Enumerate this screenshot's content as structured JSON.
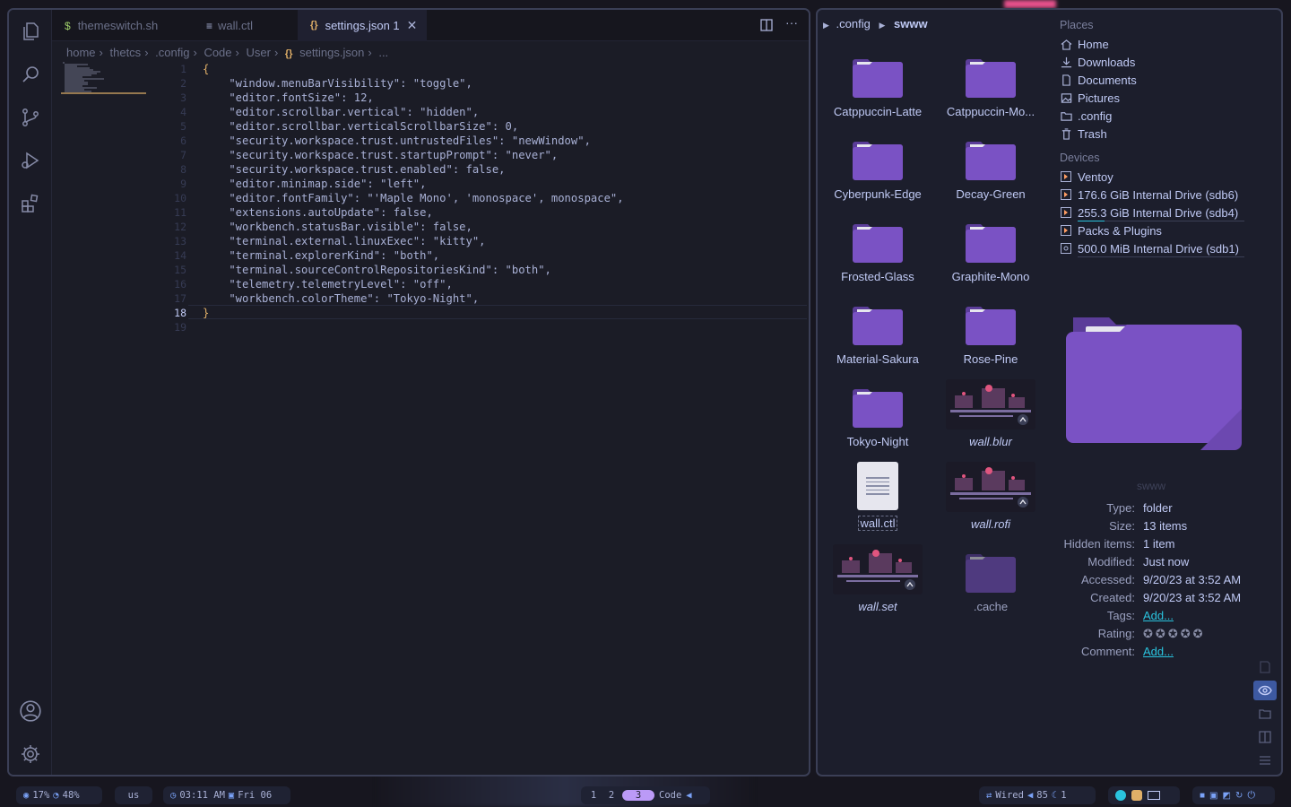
{
  "editor": {
    "tabs": [
      {
        "icon": "$",
        "label": "themeswitch.sh"
      },
      {
        "icon": "≡",
        "label": "wall.ctl"
      },
      {
        "icon": "{}",
        "label": "settings.json 1"
      }
    ],
    "breadcrumb": [
      "home",
      "thetcs",
      ".config",
      "Code",
      "User",
      "settings.json",
      "..."
    ],
    "line_numbers": [
      "1",
      "2",
      "3",
      "4",
      "5",
      "6",
      "7",
      "8",
      "9",
      "10",
      "11",
      "12",
      "13",
      "14",
      "15",
      "16",
      "17",
      "18",
      "19"
    ],
    "code_lines": [
      "{",
      "    \"window.menuBarVisibility\": \"toggle\",",
      "    \"editor.fontSize\": 12,",
      "    \"editor.scrollbar.vertical\": \"hidden\",",
      "    \"editor.scrollbar.verticalScrollbarSize\": 0,",
      "    \"security.workspace.trust.untrustedFiles\": \"newWindow\",",
      "    \"security.workspace.trust.startupPrompt\": \"never\",",
      "    \"security.workspace.trust.enabled\": false,",
      "    \"editor.minimap.side\": \"left\",",
      "    \"editor.fontFamily\": \"'Maple Mono', 'monospace', monospace\",",
      "    \"extensions.autoUpdate\": false,",
      "    \"workbench.statusBar.visible\": false,",
      "    \"terminal.external.linuxExec\": \"kitty\",",
      "    \"terminal.explorerKind\": \"both\",",
      "    \"terminal.sourceControlRepositoriesKind\": \"both\",",
      "    \"telemetry.telemetryLevel\": \"off\",",
      "    \"workbench.colorTheme\": \"Tokyo-Night\",",
      "}",
      ""
    ],
    "current_line": 18
  },
  "files": {
    "path": [
      ".config",
      "swww"
    ],
    "items": [
      {
        "label": "Catppuccin-Latte",
        "kind": "folder"
      },
      {
        "label": "Catppuccin-Mo...",
        "kind": "folder"
      },
      {
        "label": "Cyberpunk-Edge",
        "kind": "folder"
      },
      {
        "label": "Decay-Green",
        "kind": "folder"
      },
      {
        "label": "Frosted-Glass",
        "kind": "folder"
      },
      {
        "label": "Graphite-Mono",
        "kind": "folder"
      },
      {
        "label": "Material-Sakura",
        "kind": "folder"
      },
      {
        "label": "Rose-Pine",
        "kind": "folder"
      },
      {
        "label": "Tokyo-Night",
        "kind": "folder"
      },
      {
        "label": "wall.blur",
        "kind": "link-image"
      },
      {
        "label": "wall.ctl",
        "kind": "text"
      },
      {
        "label": "wall.rofi",
        "kind": "link-image"
      },
      {
        "label": "wall.set",
        "kind": "link-image"
      },
      {
        "label": ".cache",
        "kind": "folder-hidden"
      }
    ],
    "places_title": "Places",
    "places": [
      "Home",
      "Downloads",
      "Documents",
      "Pictures",
      ".config",
      "Trash"
    ],
    "devices_title": "Devices",
    "devices": [
      "Ventoy",
      "176.6 GiB Internal Drive (sdb6)",
      "255.3 GiB Internal Drive (sdb4)",
      "Packs & Plugins",
      "500.0 MiB Internal Drive (sdb1)"
    ],
    "preview_name": "swww",
    "props": [
      {
        "k": "Type:",
        "v": "folder"
      },
      {
        "k": "Size:",
        "v": "13 items"
      },
      {
        "k": "Hidden items:",
        "v": "1 item"
      },
      {
        "k": "Modified:",
        "v": "Just now"
      },
      {
        "k": "Accessed:",
        "v": "9/20/23 at 3:52 AM"
      },
      {
        "k": "Created:",
        "v": "9/20/23 at 3:52 AM"
      },
      {
        "k": "Tags:",
        "v": "Add..."
      },
      {
        "k": "Rating:",
        "v": ""
      },
      {
        "k": "Comment:",
        "v": "Add..."
      }
    ],
    "rating": 0,
    "folder_color": "#6b4ba8"
  },
  "bar": {
    "cpu": "17%",
    "mem": "48%",
    "layout": "us",
    "time": "03:11 AM",
    "date": "Fri 06",
    "workspaces": [
      "1",
      "2",
      "3"
    ],
    "active_workspace": "3",
    "active_app": "Code",
    "network": "Wired",
    "volume": "85",
    "brightness": "1"
  },
  "colors": {
    "accent": "#bb9af7",
    "bg": "#1a1b26",
    "link": "#2ac3de",
    "folder": "#7a52c4"
  }
}
